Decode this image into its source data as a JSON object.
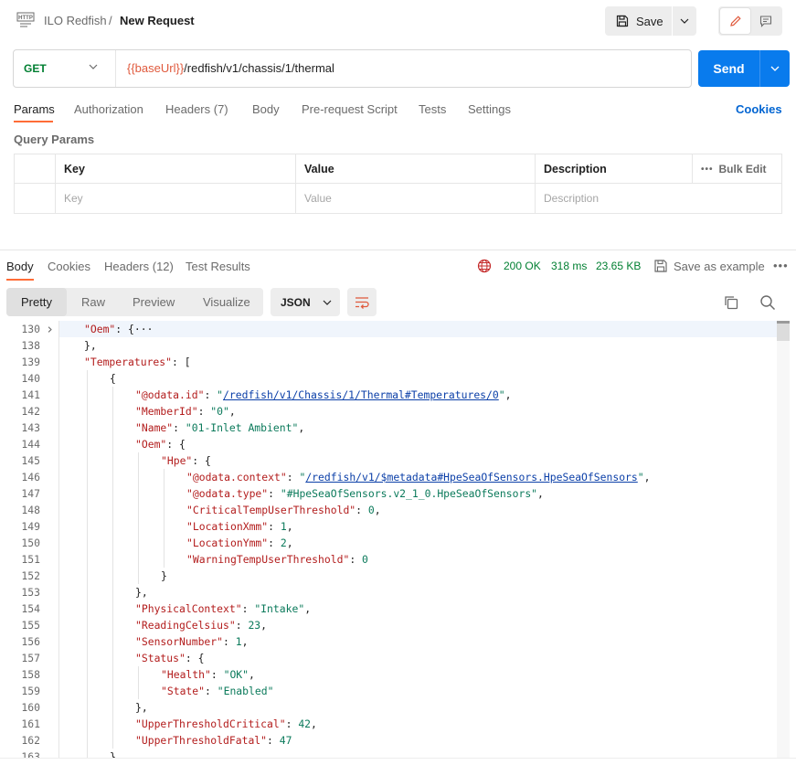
{
  "header": {
    "breadcrumb_parent": "ILO Redfish",
    "breadcrumb_sep": "/",
    "breadcrumb_current": "New Request",
    "save_label": "Save"
  },
  "request": {
    "method": "GET",
    "url_variable": "{{baseUrl}}",
    "url_path": "/redfish/v1/chassis/1/thermal",
    "send_label": "Send"
  },
  "request_tabs": [
    "Params",
    "Authorization",
    "Headers (7)",
    "Body",
    "Pre-request Script",
    "Tests",
    "Settings"
  ],
  "cookies_link": "Cookies",
  "query_params": {
    "title": "Query Params",
    "columns": [
      "Key",
      "Value",
      "Description"
    ],
    "placeholders": [
      "Key",
      "Value",
      "Description"
    ],
    "bulk_edit": "Bulk Edit",
    "more": "•••"
  },
  "response": {
    "tabs": [
      "Body",
      "Cookies",
      "Headers (12)",
      "Test Results"
    ],
    "status": "200 OK",
    "time": "318 ms",
    "size": "23.65 KB",
    "save_example": "Save as example",
    "more": "•••",
    "views": [
      "Pretty",
      "Raw",
      "Preview",
      "Visualize"
    ],
    "format": "JSON"
  },
  "colors": {
    "accent": "#ff6c37",
    "send": "#097bed",
    "get_method": "#007f31",
    "json_key": "#b31d1d",
    "json_string": "#0b7a5b",
    "json_link": "#0b3fa8"
  },
  "code_lines": [
    {
      "n": "130",
      "indent": 1,
      "fold": true,
      "parts": [
        [
          "k",
          "\"Oem\""
        ],
        [
          "p",
          ": {"
        ],
        [
          "p",
          "···"
        ]
      ]
    },
    {
      "n": "138",
      "indent": 1,
      "parts": [
        [
          "p",
          "},"
        ]
      ]
    },
    {
      "n": "139",
      "indent": 1,
      "parts": [
        [
          "k",
          "\"Temperatures\""
        ],
        [
          "p",
          ": ["
        ]
      ]
    },
    {
      "n": "140",
      "indent": 2,
      "parts": [
        [
          "p",
          "{"
        ]
      ]
    },
    {
      "n": "141",
      "indent": 3,
      "parts": [
        [
          "k",
          "\"@odata.id\""
        ],
        [
          "p",
          ": "
        ],
        [
          "s",
          "\""
        ],
        [
          "u",
          "/redfish/v1/Chassis/1/Thermal#Temperatures/0"
        ],
        [
          "s",
          "\""
        ],
        [
          "p",
          ","
        ]
      ]
    },
    {
      "n": "142",
      "indent": 3,
      "parts": [
        [
          "k",
          "\"MemberId\""
        ],
        [
          "p",
          ": "
        ],
        [
          "s",
          "\"0\""
        ],
        [
          "p",
          ","
        ]
      ]
    },
    {
      "n": "143",
      "indent": 3,
      "parts": [
        [
          "k",
          "\"Name\""
        ],
        [
          "p",
          ": "
        ],
        [
          "s",
          "\"01-Inlet Ambient\""
        ],
        [
          "p",
          ","
        ]
      ]
    },
    {
      "n": "144",
      "indent": 3,
      "parts": [
        [
          "k",
          "\"Oem\""
        ],
        [
          "p",
          ": {"
        ]
      ]
    },
    {
      "n": "145",
      "indent": 4,
      "parts": [
        [
          "k",
          "\"Hpe\""
        ],
        [
          "p",
          ": {"
        ]
      ]
    },
    {
      "n": "146",
      "indent": 5,
      "parts": [
        [
          "k",
          "\"@odata.context\""
        ],
        [
          "p",
          ": "
        ],
        [
          "s",
          "\""
        ],
        [
          "u",
          "/redfish/v1/$metadata#HpeSeaOfSensors.HpeSeaOfSensors"
        ],
        [
          "s",
          "\""
        ],
        [
          "p",
          ","
        ]
      ]
    },
    {
      "n": "147",
      "indent": 5,
      "parts": [
        [
          "k",
          "\"@odata.type\""
        ],
        [
          "p",
          ": "
        ],
        [
          "s",
          "\"#HpeSeaOfSensors.v2_1_0.HpeSeaOfSensors\""
        ],
        [
          "p",
          ","
        ]
      ]
    },
    {
      "n": "148",
      "indent": 5,
      "parts": [
        [
          "k",
          "\"CriticalTempUserThreshold\""
        ],
        [
          "p",
          ": "
        ],
        [
          "n",
          "0"
        ],
        [
          "p",
          ","
        ]
      ]
    },
    {
      "n": "149",
      "indent": 5,
      "parts": [
        [
          "k",
          "\"LocationXmm\""
        ],
        [
          "p",
          ": "
        ],
        [
          "n",
          "1"
        ],
        [
          "p",
          ","
        ]
      ]
    },
    {
      "n": "150",
      "indent": 5,
      "parts": [
        [
          "k",
          "\"LocationYmm\""
        ],
        [
          "p",
          ": "
        ],
        [
          "n",
          "2"
        ],
        [
          "p",
          ","
        ]
      ]
    },
    {
      "n": "151",
      "indent": 5,
      "parts": [
        [
          "k",
          "\"WarningTempUserThreshold\""
        ],
        [
          "p",
          ": "
        ],
        [
          "n",
          "0"
        ]
      ]
    },
    {
      "n": "152",
      "indent": 4,
      "parts": [
        [
          "p",
          "}"
        ]
      ]
    },
    {
      "n": "153",
      "indent": 3,
      "parts": [
        [
          "p",
          "},"
        ]
      ]
    },
    {
      "n": "154",
      "indent": 3,
      "parts": [
        [
          "k",
          "\"PhysicalContext\""
        ],
        [
          "p",
          ": "
        ],
        [
          "s",
          "\"Intake\""
        ],
        [
          "p",
          ","
        ]
      ]
    },
    {
      "n": "155",
      "indent": 3,
      "parts": [
        [
          "k",
          "\"ReadingCelsius\""
        ],
        [
          "p",
          ": "
        ],
        [
          "n",
          "23"
        ],
        [
          "p",
          ","
        ]
      ]
    },
    {
      "n": "156",
      "indent": 3,
      "parts": [
        [
          "k",
          "\"SensorNumber\""
        ],
        [
          "p",
          ": "
        ],
        [
          "n",
          "1"
        ],
        [
          "p",
          ","
        ]
      ]
    },
    {
      "n": "157",
      "indent": 3,
      "parts": [
        [
          "k",
          "\"Status\""
        ],
        [
          "p",
          ": {"
        ]
      ]
    },
    {
      "n": "158",
      "indent": 4,
      "parts": [
        [
          "k",
          "\"Health\""
        ],
        [
          "p",
          ": "
        ],
        [
          "s",
          "\"OK\""
        ],
        [
          "p",
          ","
        ]
      ]
    },
    {
      "n": "159",
      "indent": 4,
      "parts": [
        [
          "k",
          "\"State\""
        ],
        [
          "p",
          ": "
        ],
        [
          "s",
          "\"Enabled\""
        ]
      ]
    },
    {
      "n": "160",
      "indent": 3,
      "parts": [
        [
          "p",
          "},"
        ]
      ]
    },
    {
      "n": "161",
      "indent": 3,
      "parts": [
        [
          "k",
          "\"UpperThresholdCritical\""
        ],
        [
          "p",
          ": "
        ],
        [
          "n",
          "42"
        ],
        [
          "p",
          ","
        ]
      ]
    },
    {
      "n": "162",
      "indent": 3,
      "parts": [
        [
          "k",
          "\"UpperThresholdFatal\""
        ],
        [
          "p",
          ": "
        ],
        [
          "n",
          "47"
        ]
      ]
    },
    {
      "n": "163",
      "indent": 2,
      "parts": [
        [
          "p",
          "},"
        ]
      ]
    }
  ]
}
